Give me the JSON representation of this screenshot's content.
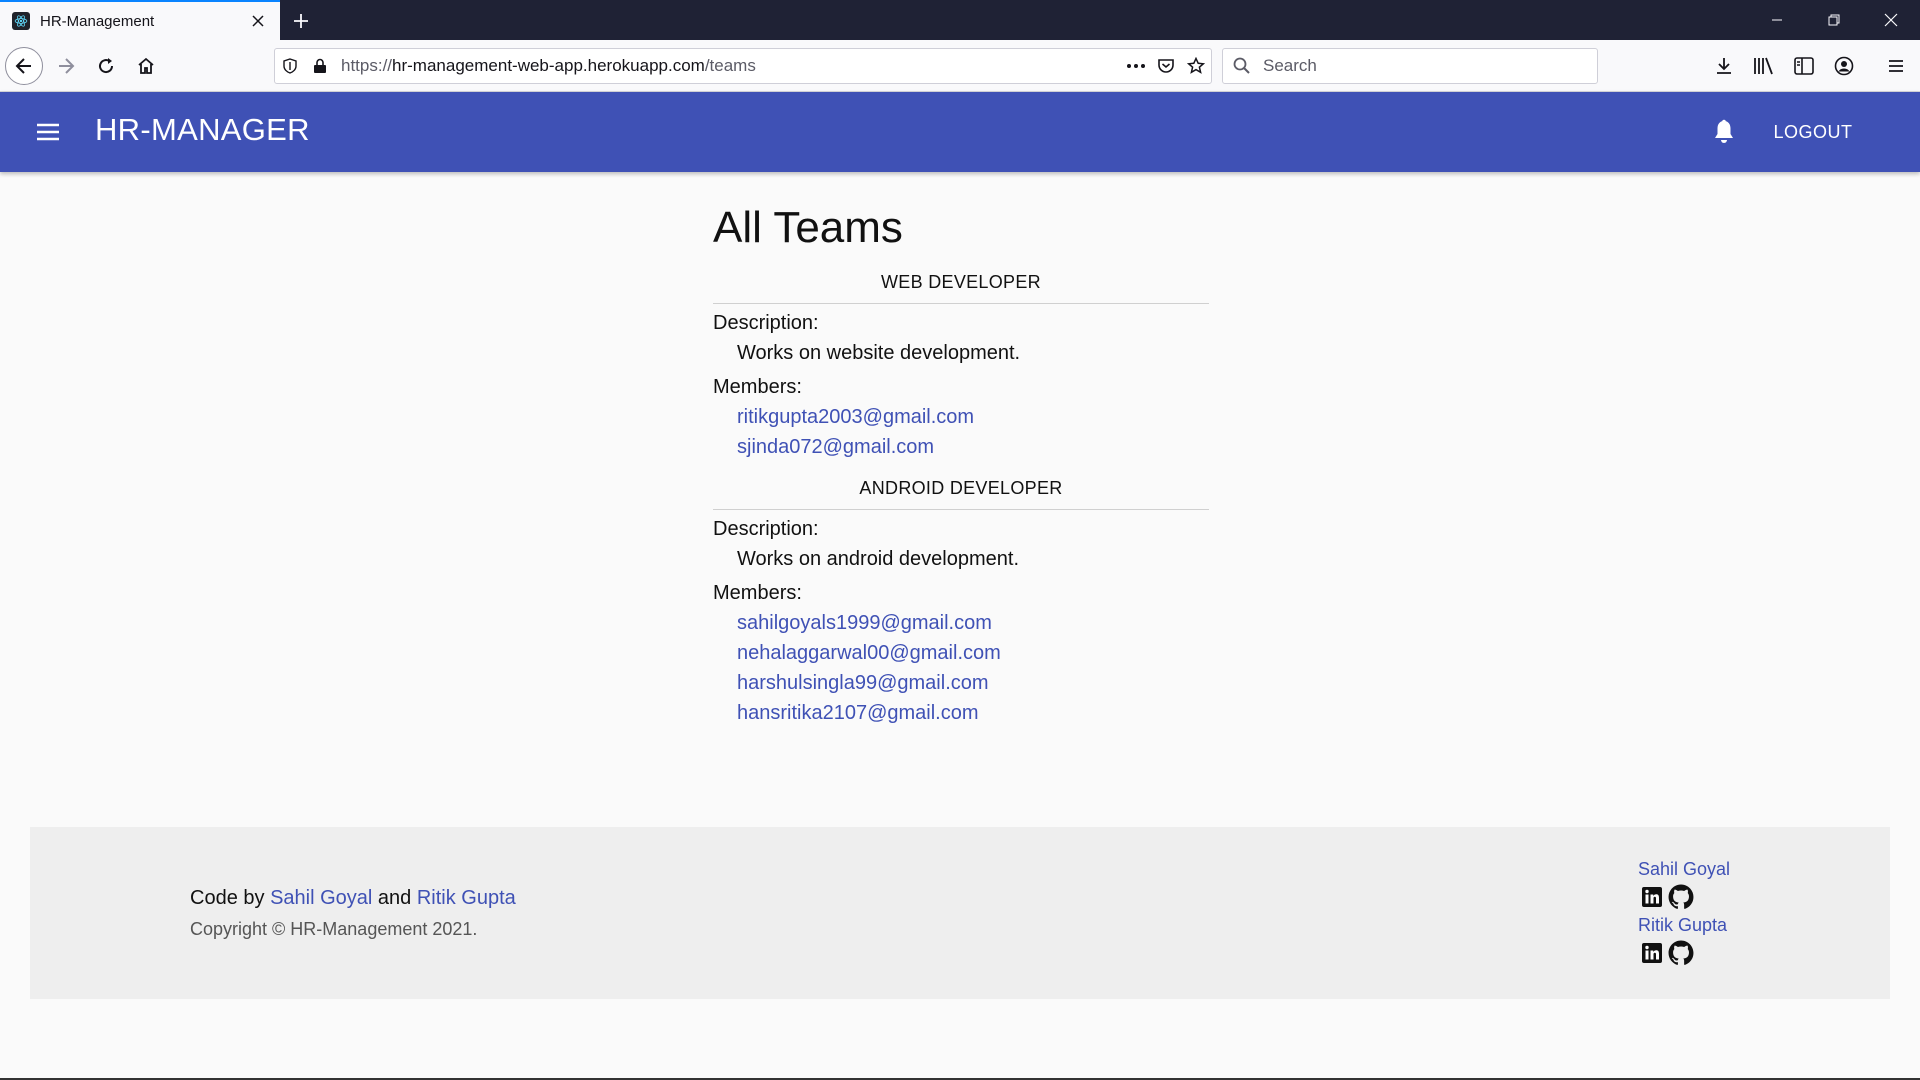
{
  "browser": {
    "tab_title": "HR-Management",
    "url_scheme": "https://",
    "url_host": "hr-management-web-app.herokuapp.com",
    "url_path": "/teams",
    "search_placeholder": "Search"
  },
  "appbar": {
    "brand": "HR-MANAGER",
    "logout_label": "LOGOUT",
    "color": "#3f51b5"
  },
  "page": {
    "title": "All Teams",
    "description_label": "Description:",
    "members_label": "Members:"
  },
  "teams": [
    {
      "name": "WEB DEVELOPER",
      "description": "Works on website development.",
      "members": [
        "ritikgupta2003@gmail.com",
        "sjinda072@gmail.com"
      ]
    },
    {
      "name": "ANDROID DEVELOPER",
      "description": "Works on android development.",
      "members": [
        "sahilgoyals1999@gmail.com",
        "nehalaggarwal00@gmail.com",
        "harshulsingla99@gmail.com",
        "hansritika2107@gmail.com"
      ]
    }
  ],
  "footer": {
    "code_by": "Code by",
    "and": "and",
    "author1": "Sahil Goyal",
    "author2": "Ritik Gupta",
    "copyright": "Copyright © HR-Management 2021."
  },
  "icons": {
    "favicon": "react-icon",
    "menu": "hamburger-icon",
    "notifications": "bell-icon",
    "social": [
      "linkedin-icon",
      "github-icon"
    ]
  }
}
